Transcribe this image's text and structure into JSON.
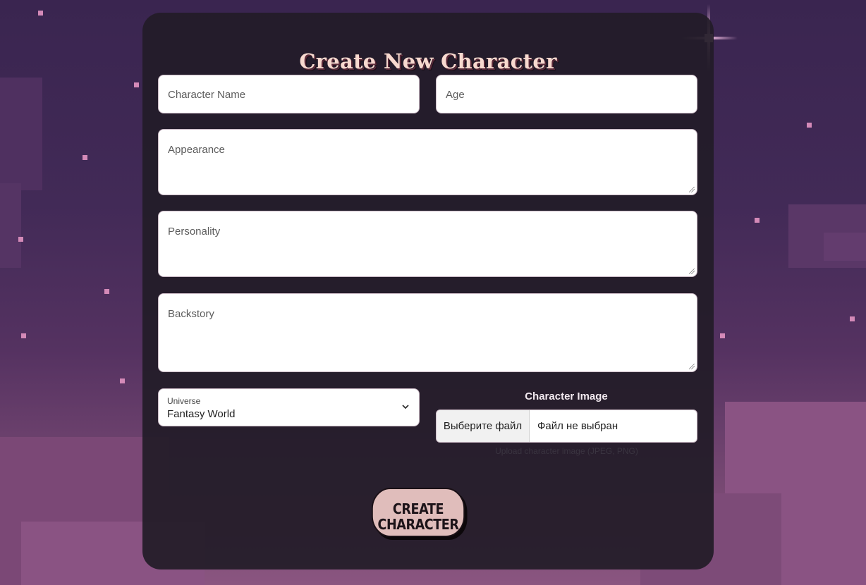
{
  "form": {
    "title": "Create New Character",
    "character_name_placeholder": "Character Name",
    "age_placeholder": "Age",
    "appearance_placeholder": "Appearance",
    "personality_placeholder": "Personality",
    "backstory_placeholder": "Backstory",
    "universe": {
      "label": "Universe",
      "selected": "Fantasy World"
    },
    "image": {
      "label": "Character Image",
      "choose_button": "Выберите файл",
      "status": "Файл не выбран",
      "hint": "Upload character image (JPEG, PNG)"
    },
    "submit_label": "CREATE CHARACTER"
  },
  "icons": {
    "dropdown": "chevron-down-icon",
    "resize": "resize-grip-icon",
    "sparkle": "sparkle-star-icon"
  },
  "colors": {
    "card_background": "#221c28",
    "title": "#f7d9cf",
    "button": "#e0bdbb",
    "star": "#d48ab8"
  }
}
